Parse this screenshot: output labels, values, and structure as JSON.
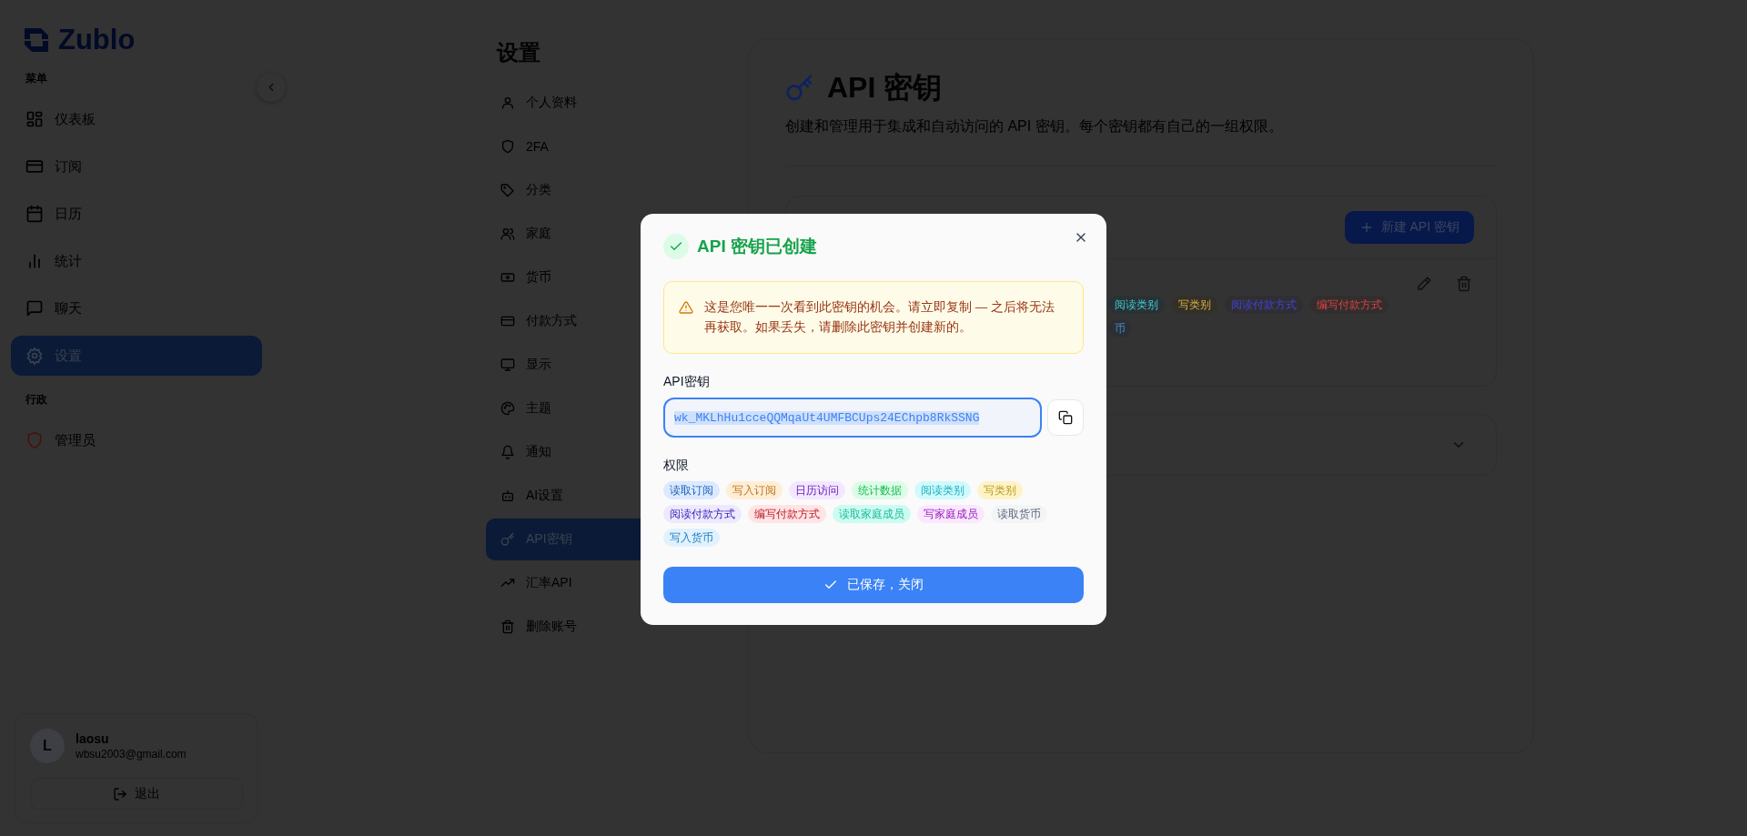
{
  "sidebar": {
    "logo": "Zublo",
    "sections": [
      {
        "heading": "菜单",
        "items": [
          {
            "label": "仪表板",
            "selected": false
          },
          {
            "label": "订阅",
            "selected": false
          },
          {
            "label": "日历",
            "selected": false
          },
          {
            "label": "统计",
            "selected": false
          },
          {
            "label": "聊天",
            "selected": false
          },
          {
            "label": "设置",
            "selected": true
          }
        ]
      },
      {
        "heading": "行政",
        "items": [
          {
            "label": "管理员",
            "selected": false
          }
        ]
      }
    ],
    "user": {
      "avatar": "L",
      "name": "laosu",
      "email": "wbsu2003@gmail.com"
    },
    "logout": "退出"
  },
  "settings_nav": {
    "title": "设置",
    "items": [
      {
        "label": "个人资料",
        "selected": false
      },
      {
        "label": "2FA",
        "selected": false
      },
      {
        "label": "分类",
        "selected": false
      },
      {
        "label": "家庭",
        "selected": false
      },
      {
        "label": "货币",
        "selected": false
      },
      {
        "label": "付款方式",
        "selected": false
      },
      {
        "label": "显示",
        "selected": false
      },
      {
        "label": "主题",
        "selected": false
      },
      {
        "label": "通知",
        "selected": false
      },
      {
        "label": "AI设置",
        "selected": false
      },
      {
        "label": "API密钥",
        "selected": true
      },
      {
        "label": "汇率API",
        "selected": false
      },
      {
        "label": "删除账号",
        "selected": false
      }
    ]
  },
  "page": {
    "title": "API 密钥",
    "description": "创建和管理用于集成和自动访问的 API 密钥。每个密钥都有自己的一组权限。",
    "new_button": "新建 API 密钥",
    "key_tag_rows": [
      [
        {
          "label": "阅读类别",
          "color": "#293233"
        },
        {
          "label": "写类别",
          "color": "#333028"
        },
        {
          "label": "阅读付款方式",
          "color": "#2f2f33"
        },
        {
          "label": "编写付款方式",
          "color": "#332e2e"
        }
      ],
      [
        {
          "label": "币",
          "color": "#2d3033"
        }
      ]
    ]
  },
  "dialog": {
    "title": "API 密钥已创建",
    "warning": "这是您唯一一次看到此密钥的机会。请立即复制 — 之后将无法再获取。如果丢失，请删除此密钥并创建新的。",
    "key_label": "API密钥",
    "key_value": "wk_MKLhHu1cceQQMqaUt4UMFBCUps24EChpb8RkSSNG",
    "permissions_label": "权限",
    "permissions": [
      {
        "label": "读取订阅",
        "color": "#dbeafe"
      },
      {
        "label": "写入订阅",
        "color": "#ffedd5"
      },
      {
        "label": "日历访问",
        "color": "#f3e8ff"
      },
      {
        "label": "统计数据",
        "color": "#dcfce7"
      },
      {
        "label": "阅读类别",
        "color": "#cffafe"
      },
      {
        "label": "写类别",
        "color": "#fef3c7"
      },
      {
        "label": "阅读付款方式",
        "color": "#ede9fe"
      },
      {
        "label": "编写付款方式",
        "color": "#ffe4e6"
      },
      {
        "label": "读取家庭成员",
        "color": "#ccfbf1"
      },
      {
        "label": "写家庭成员",
        "color": "#fae8ff"
      },
      {
        "label": "读取货币",
        "color": "#f3f4f6"
      },
      {
        "label": "写入货币",
        "color": "#e0f2fe"
      }
    ],
    "confirm_button": "已保存，关闭"
  }
}
